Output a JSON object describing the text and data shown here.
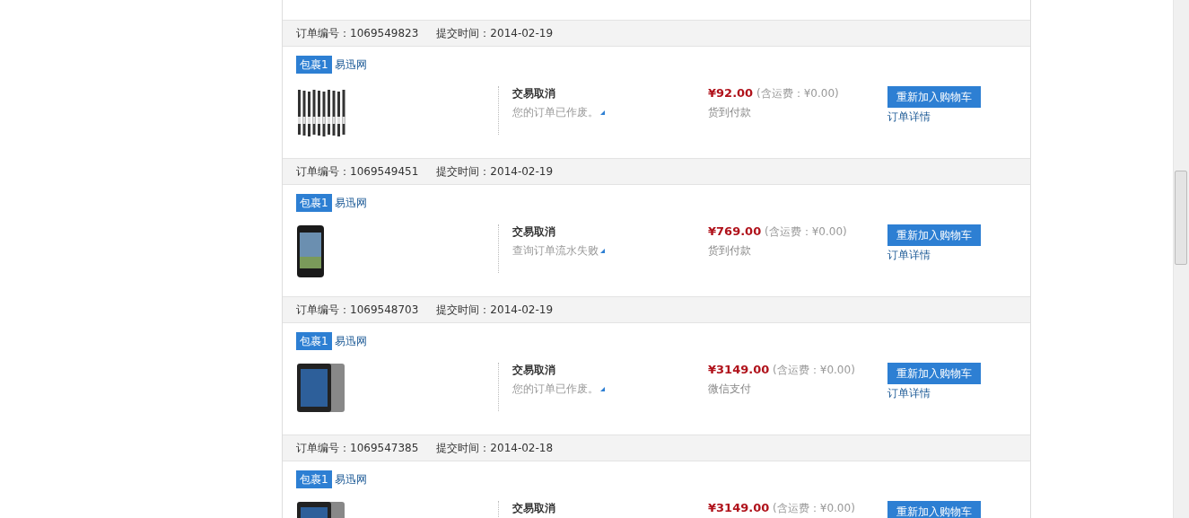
{
  "orders": [
    {
      "number_label": "订单编号：",
      "number": "1069549823",
      "time_label": "提交时间：",
      "time": "2014-02-19",
      "parcel": "包裹1",
      "shop": "易迅网",
      "kind": "pens",
      "status": "交易取消",
      "status_note": "您的订单已作废。",
      "price": "¥92.00",
      "shipping": "(含运费：¥0.00)",
      "payment": "货到付款",
      "button": "重新加入购物车",
      "detail_link": "订单详情"
    },
    {
      "number_label": "订单编号：",
      "number": "1069549451",
      "time_label": "提交时间：",
      "time": "2014-02-19",
      "parcel": "包裹1",
      "shop": "易迅网",
      "kind": "phone",
      "status": "交易取消",
      "status_note": "查询订单流水失败",
      "price": "¥769.00",
      "shipping": "(含运费：¥0.00)",
      "payment": "货到付款",
      "button": "重新加入购物车",
      "detail_link": "订单详情"
    },
    {
      "number_label": "订单编号：",
      "number": "1069548703",
      "time_label": "提交时间：",
      "time": "2014-02-19",
      "parcel": "包裹1",
      "shop": "易迅网",
      "kind": "tablet",
      "status": "交易取消",
      "status_note": "您的订单已作废。",
      "price": "¥3149.00",
      "shipping": "(含运费：¥0.00)",
      "payment": "微信支付",
      "button": "重新加入购物车",
      "detail_link": "订单详情"
    },
    {
      "number_label": "订单编号：",
      "number": "1069547385",
      "time_label": "提交时间：",
      "time": "2014-02-18",
      "parcel": "包裹1",
      "shop": "易迅网",
      "kind": "tablet",
      "status": "交易取消",
      "price": "¥3149.00",
      "shipping": "(含运费：¥0.00)",
      "button": "重新加入购物车"
    }
  ]
}
